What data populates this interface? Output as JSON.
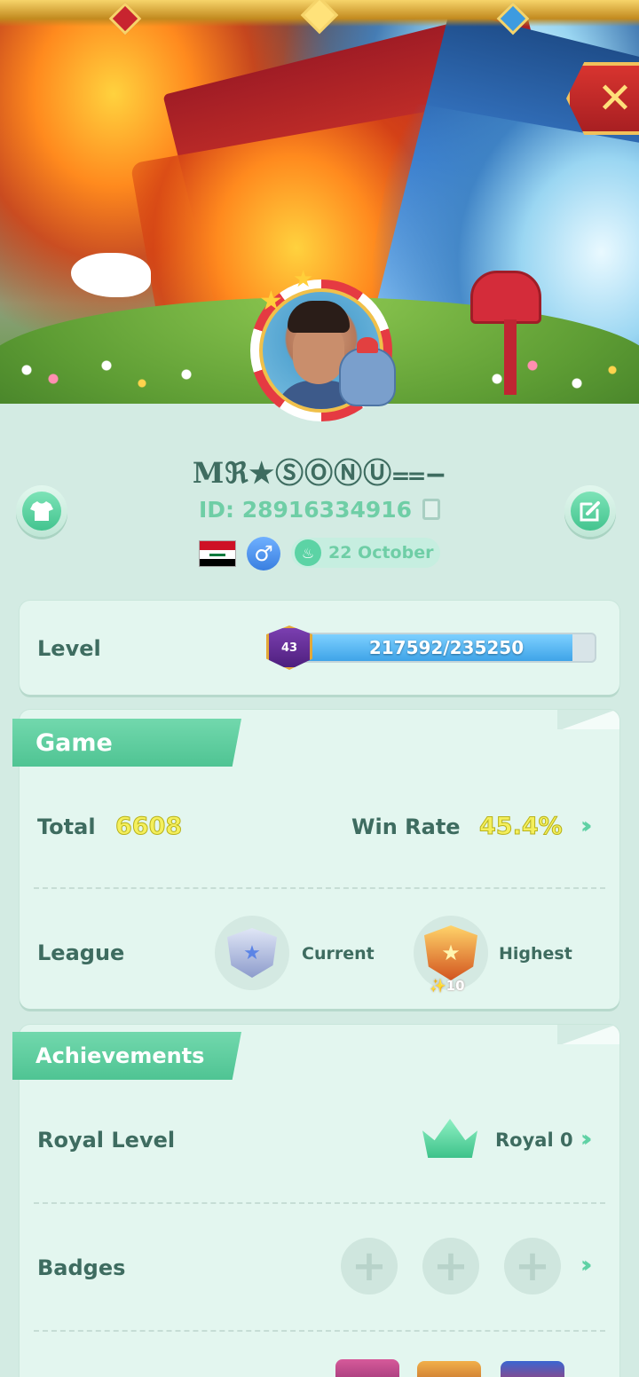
{
  "header": {
    "close_icon": "close-icon"
  },
  "profile": {
    "username": "Mℜ★ⓈⓄⓃⓊ⩵‒",
    "id_text": "ID: 28916334916",
    "gender_symbol": "♂",
    "birthday": "22 October",
    "flag": "Iraq"
  },
  "level": {
    "label": "Level",
    "badge": "43",
    "progress_text": "217592/235250",
    "current": 217592,
    "max": 235250
  },
  "game": {
    "title": "Game",
    "total_label": "Total",
    "total_value": "6608",
    "winrate_label": "Win Rate",
    "winrate_value": "45.4%",
    "league_label": "League",
    "current_label": "Current",
    "highest_label": "Highest",
    "highest_stars": "✨10"
  },
  "achievements": {
    "title": "Achievements",
    "royal_label": "Royal Level",
    "royal_value": "Royal 0",
    "badges_label": "Badges"
  },
  "colors": {
    "accent": "#4fc493",
    "page_bg": "#d3ebe3",
    "card_bg": "#e3f6ef",
    "text": "#3e6c60",
    "highlight_number": "#f4ef5c"
  }
}
